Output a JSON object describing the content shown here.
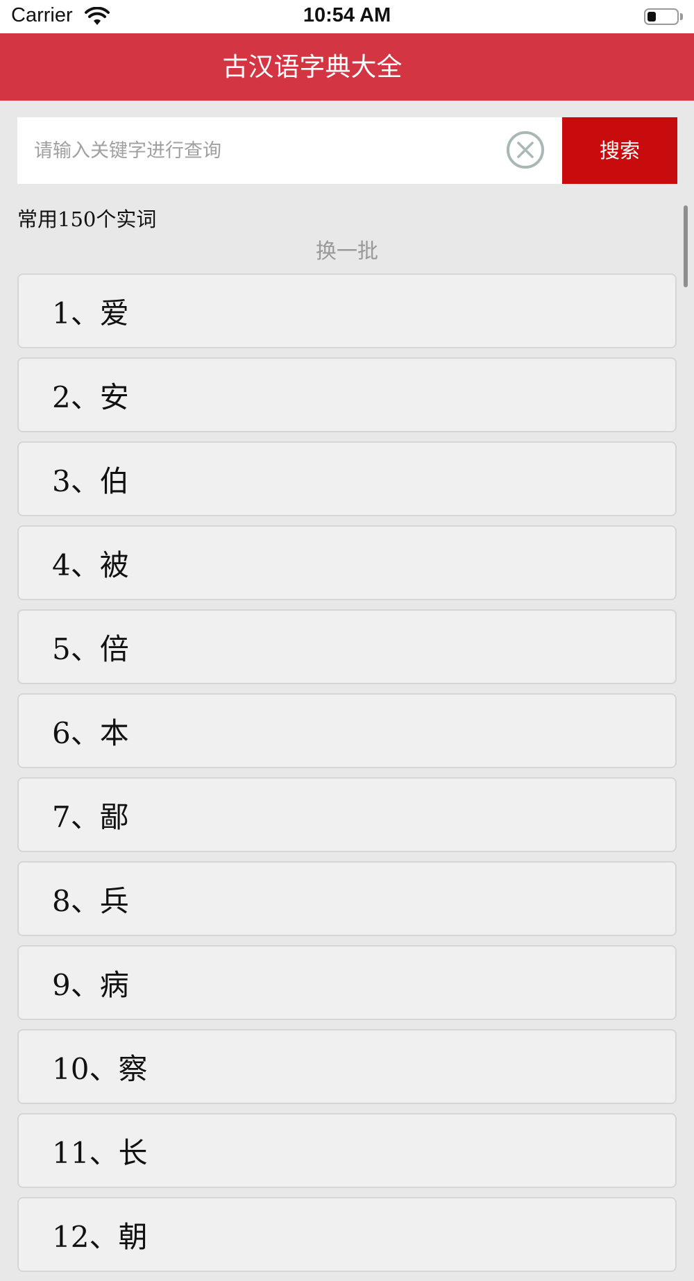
{
  "status_bar": {
    "carrier": "Carrier",
    "time": "10:54 AM",
    "battery_level": 0.3
  },
  "header": {
    "title": "古汉语字典大全"
  },
  "search": {
    "placeholder": "请输入关键字进行查询",
    "value": "",
    "button_label": "搜索",
    "clear_icon": "close-circle-icon"
  },
  "section": {
    "title": "常用150个实词",
    "refresh_label": "换一批"
  },
  "colors": {
    "header_bg": "#d33542",
    "search_button_bg": "#c80c0e",
    "page_bg": "#e8e8e8"
  },
  "items": [
    {
      "label": "1、爱"
    },
    {
      "label": "2、安"
    },
    {
      "label": "3、伯"
    },
    {
      "label": "4、被"
    },
    {
      "label": "5、倍"
    },
    {
      "label": "6、本"
    },
    {
      "label": "7、鄙"
    },
    {
      "label": "8、兵"
    },
    {
      "label": "9、病"
    },
    {
      "label": "10、察"
    },
    {
      "label": "11、长"
    },
    {
      "label": "12、朝"
    }
  ]
}
